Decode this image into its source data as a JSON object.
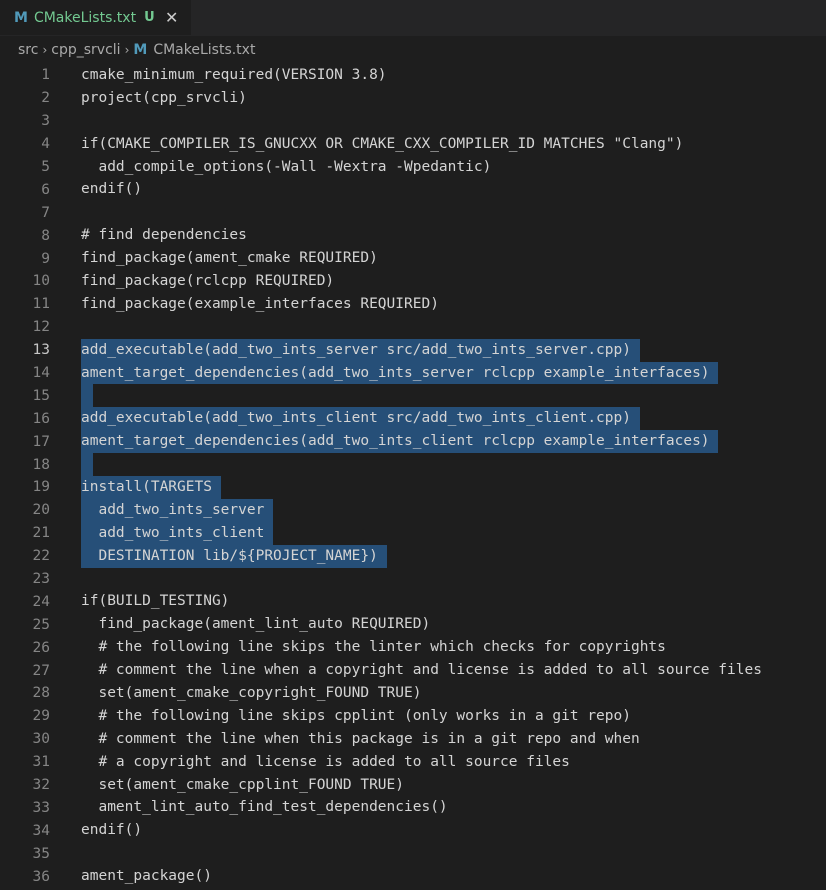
{
  "tab": {
    "title": "CMakeLists.txt",
    "status": "U",
    "icon": "M"
  },
  "breadcrumb": {
    "items": [
      "src",
      "cpp_srvcli"
    ],
    "file": "CMakeLists.txt",
    "icon": "M"
  },
  "editor": {
    "lines": [
      {
        "n": "1",
        "text": "cmake_minimum_required(VERSION 3.8)",
        "sel": false
      },
      {
        "n": "2",
        "text": "project(cpp_srvcli)",
        "sel": false
      },
      {
        "n": "3",
        "text": "",
        "sel": false
      },
      {
        "n": "4",
        "text": "if(CMAKE_COMPILER_IS_GNUCXX OR CMAKE_CXX_COMPILER_ID MATCHES \"Clang\")",
        "sel": false
      },
      {
        "n": "5",
        "text": "  add_compile_options(-Wall -Wextra -Wpedantic)",
        "sel": false
      },
      {
        "n": "6",
        "text": "endif()",
        "sel": false
      },
      {
        "n": "7",
        "text": "",
        "sel": false
      },
      {
        "n": "8",
        "text": "# find dependencies",
        "sel": false
      },
      {
        "n": "9",
        "text": "find_package(ament_cmake REQUIRED)",
        "sel": false
      },
      {
        "n": "10",
        "text": "find_package(rclcpp REQUIRED)",
        "sel": false
      },
      {
        "n": "11",
        "text": "find_package(example_interfaces REQUIRED)",
        "sel": false
      },
      {
        "n": "12",
        "text": "",
        "sel": false
      },
      {
        "n": "13",
        "text": "add_executable(add_two_ints_server src/add_two_ints_server.cpp)",
        "sel": true
      },
      {
        "n": "14",
        "text": "ament_target_dependencies(add_two_ints_server rclcpp example_interfaces)",
        "sel": true
      },
      {
        "n": "15",
        "text": "",
        "sel": true
      },
      {
        "n": "16",
        "text": "add_executable(add_two_ints_client src/add_two_ints_client.cpp)",
        "sel": true
      },
      {
        "n": "17",
        "text": "ament_target_dependencies(add_two_ints_client rclcpp example_interfaces)",
        "sel": true
      },
      {
        "n": "18",
        "text": "",
        "sel": true
      },
      {
        "n": "19",
        "text": "install(TARGETS",
        "sel": true
      },
      {
        "n": "20",
        "text": "  add_two_ints_server",
        "sel": true
      },
      {
        "n": "21",
        "text": "  add_two_ints_client",
        "sel": true
      },
      {
        "n": "22",
        "text": "  DESTINATION lib/${PROJECT_NAME})",
        "sel": true
      },
      {
        "n": "23",
        "text": "",
        "sel": false
      },
      {
        "n": "24",
        "text": "if(BUILD_TESTING)",
        "sel": false
      },
      {
        "n": "25",
        "text": "  find_package(ament_lint_auto REQUIRED)",
        "sel": false
      },
      {
        "n": "26",
        "text": "  # the following line skips the linter which checks for copyrights",
        "sel": false
      },
      {
        "n": "27",
        "text": "  # comment the line when a copyright and license is added to all source files",
        "sel": false
      },
      {
        "n": "28",
        "text": "  set(ament_cmake_copyright_FOUND TRUE)",
        "sel": false
      },
      {
        "n": "29",
        "text": "  # the following line skips cpplint (only works in a git repo)",
        "sel": false
      },
      {
        "n": "30",
        "text": "  # comment the line when this package is in a git repo and when",
        "sel": false
      },
      {
        "n": "31",
        "text": "  # a copyright and license is added to all source files",
        "sel": false
      },
      {
        "n": "32",
        "text": "  set(ament_cmake_cpplint_FOUND TRUE)",
        "sel": false
      },
      {
        "n": "33",
        "text": "  ament_lint_auto_find_test_dependencies()",
        "sel": false
      },
      {
        "n": "34",
        "text": "endif()",
        "sel": false
      },
      {
        "n": "35",
        "text": "",
        "sel": false
      },
      {
        "n": "36",
        "text": "ament_package()",
        "sel": false
      }
    ]
  },
  "colors": {
    "selection": "#264f78",
    "tab_modified": "#73c991",
    "cmake_icon": "#519aba"
  }
}
